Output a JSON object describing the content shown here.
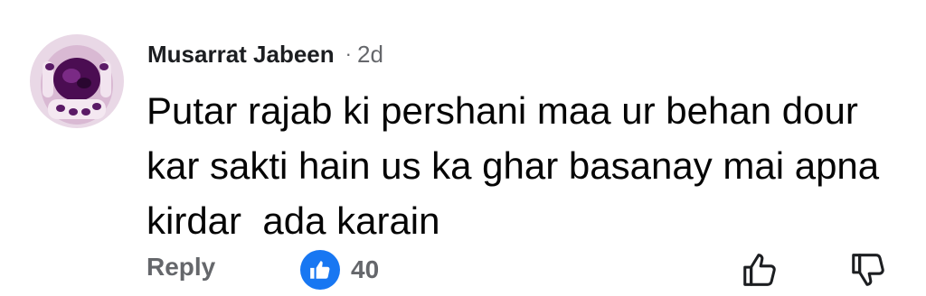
{
  "comment": {
    "author": "Musarrat Jabeen",
    "separator": "·",
    "time": "2d",
    "text": "Putar rajab ki pershani maa ur behan dour\nkar sakti hain us ka ghar basanay mai apna\nkirdar  ada karain",
    "avatar_icon": "avatar-photo",
    "actions": {
      "reply_label": "Reply",
      "like_count": "40",
      "like_icon": "thumbs-up-icon",
      "upvote_icon": "thumbs-up-outline-icon",
      "downvote_icon": "thumbs-down-outline-icon"
    }
  },
  "colors": {
    "like_blue": "#1877f2",
    "secondary_text": "#65676b",
    "primary_text": "#050505"
  }
}
